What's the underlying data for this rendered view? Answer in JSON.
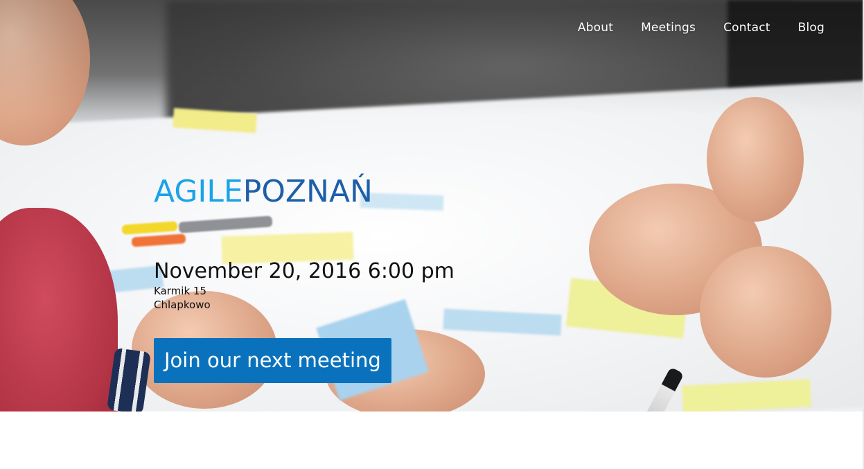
{
  "nav": {
    "items": [
      {
        "label": "About"
      },
      {
        "label": "Meetings"
      },
      {
        "label": "Contact"
      },
      {
        "label": "Blog"
      }
    ]
  },
  "logo": {
    "part1": "AGILE",
    "part2": "POZNAŃ",
    "colors": {
      "part1": "#1aa3e8",
      "part2": "#1d5fa8"
    }
  },
  "event": {
    "datetime": "November 20, 2016 6:00 pm",
    "address_line1": "Karmik 15",
    "address_line2": "Chlapkowo"
  },
  "cta": {
    "label": "Join our next meeting",
    "color": "#0a72bd"
  }
}
